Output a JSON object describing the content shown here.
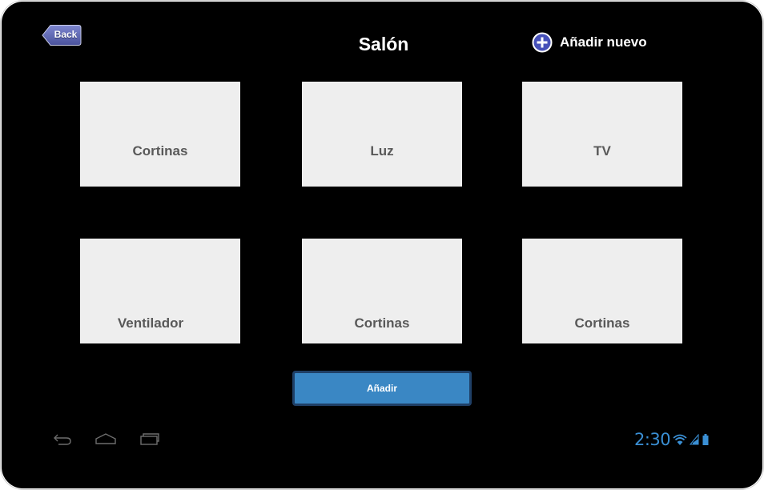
{
  "header": {
    "back_label": "Back",
    "title": "Salón",
    "add_new_label": "Añadir nuevo"
  },
  "tiles": [
    {
      "label": "Cortinas"
    },
    {
      "label": "Luz"
    },
    {
      "label": "TV"
    },
    {
      "label": "Ventilador"
    },
    {
      "label": "Cortinas"
    },
    {
      "label": "Cortinas"
    }
  ],
  "add_button_label": "Añadir",
  "status_bar": {
    "time": "2:30",
    "icons": [
      "wifi-icon",
      "signal-icon",
      "battery-icon"
    ]
  },
  "nav_bar": {
    "icons": [
      "back-nav-icon",
      "home-nav-icon",
      "recent-apps-icon"
    ]
  },
  "colors": {
    "background": "#000000",
    "tile": "#eeeeee",
    "tile_text": "#595959",
    "accent_blue": "#3a87c4",
    "status_blue": "#3a8fd4",
    "back_button": "#5a63ad"
  }
}
